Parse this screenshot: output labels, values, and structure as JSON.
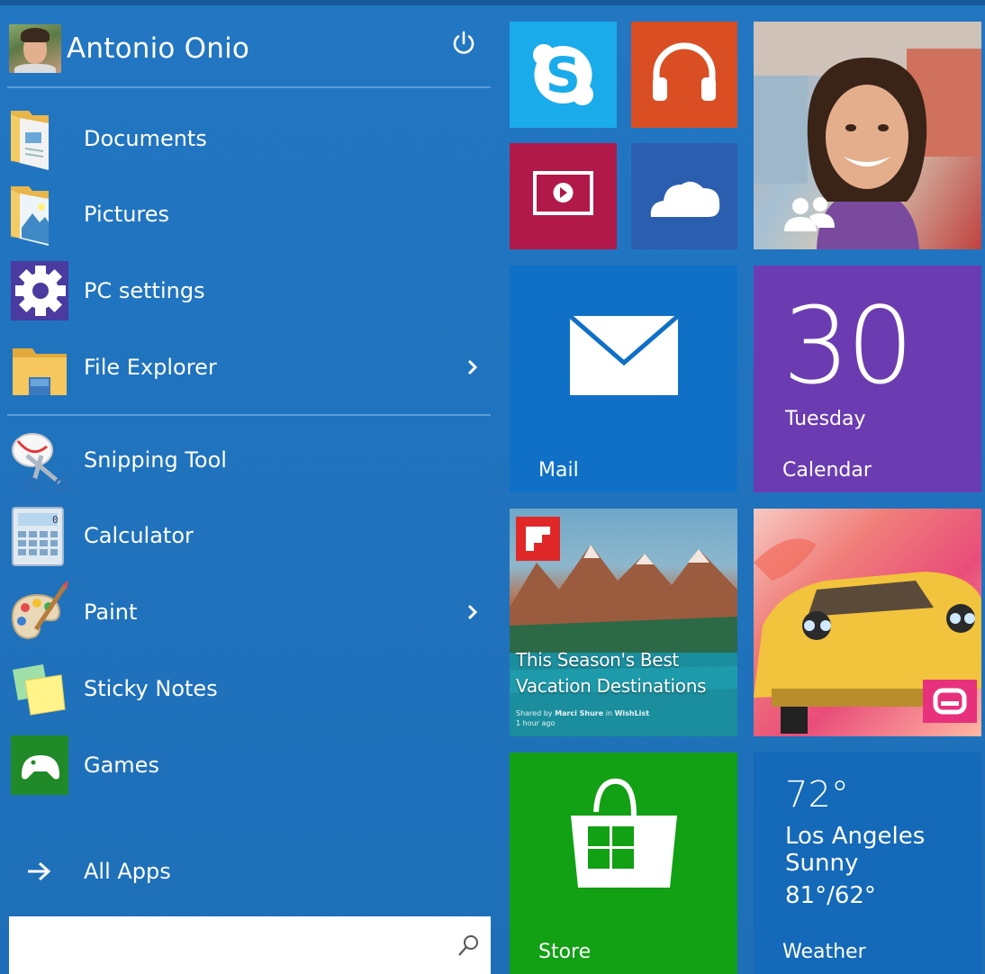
{
  "user": {
    "name": "Antonio Onio"
  },
  "places": [
    {
      "label": "Documents",
      "icon": "documents-folder-icon"
    },
    {
      "label": "Pictures",
      "icon": "pictures-folder-icon"
    },
    {
      "label": "PC settings",
      "icon": "gear-icon"
    },
    {
      "label": "File Explorer",
      "icon": "file-explorer-icon",
      "has_submenu": true
    }
  ],
  "apps": [
    {
      "label": "Snipping Tool",
      "icon": "snipping-tool-icon"
    },
    {
      "label": "Calculator",
      "icon": "calculator-icon"
    },
    {
      "label": "Paint",
      "icon": "paint-palette-icon",
      "has_submenu": true
    },
    {
      "label": "Sticky Notes",
      "icon": "sticky-notes-icon"
    },
    {
      "label": "Games",
      "icon": "game-controller-icon"
    }
  ],
  "all_apps": {
    "label": "All Apps"
  },
  "search": {
    "value": "",
    "placeholder": ""
  },
  "tiles": {
    "skype": {
      "icon": "skype-icon",
      "color": "#1aabeb"
    },
    "music": {
      "icon": "headphones-icon",
      "color": "#d94f23"
    },
    "video": {
      "icon": "video-play-icon",
      "color": "#b1194a"
    },
    "onedrive": {
      "icon": "cloud-icon",
      "color": "#2b5eae"
    },
    "people": {
      "icon": "people-icon"
    },
    "mail": {
      "label": "Mail",
      "icon": "envelope-icon",
      "color": "#0f70c6"
    },
    "calendar": {
      "day_number": "30",
      "weekday": "Tuesday",
      "label": "Calendar",
      "color": "#6b3cb1"
    },
    "flipboard": {
      "icon": "flipboard-icon",
      "headline_line1": "This Season's Best",
      "headline_line2": "Vacation Destinations",
      "shared_prefix": "Shared by ",
      "shared_by": "Marci Shure",
      "shared_in": " in ",
      "magazine": "WishList",
      "time_ago": "1 hour ago"
    },
    "game": {
      "icon": "gameloft-icon"
    },
    "store": {
      "label": "Store",
      "icon": "shopping-bag-icon",
      "color": "#12a014"
    },
    "weather": {
      "temperature": "72°",
      "city": "Los Angeles",
      "condition": "Sunny",
      "high_low": "81°/62°",
      "label": "Weather",
      "color": "#1469b8"
    }
  }
}
